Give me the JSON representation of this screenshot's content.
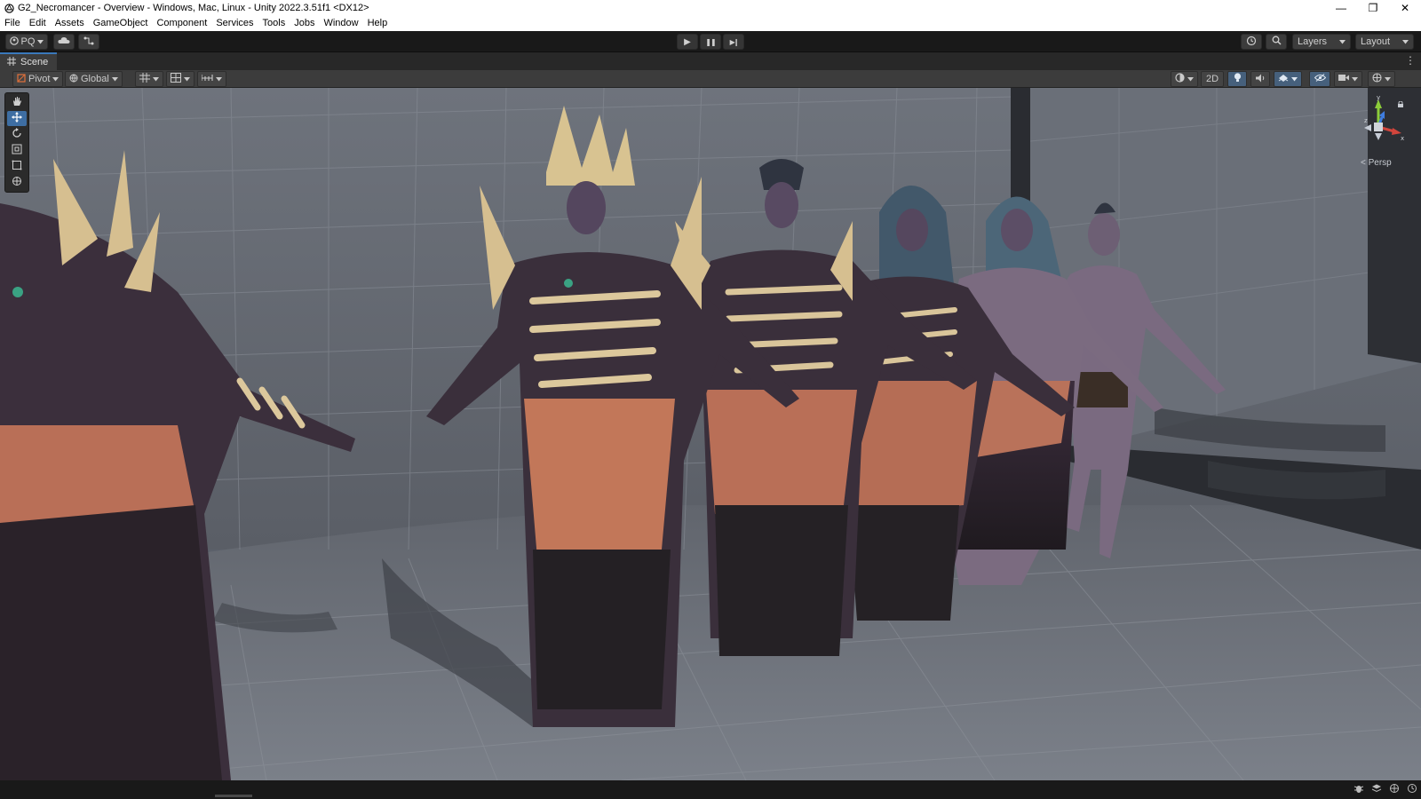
{
  "window": {
    "title": "G2_Necromancer - Overview - Windows, Mac, Linux - Unity 2022.3.51f1 <DX12>",
    "minimize_glyph": "—",
    "restore_glyph": "❐",
    "close_glyph": "✕"
  },
  "menu": {
    "items": [
      "File",
      "Edit",
      "Assets",
      "GameObject",
      "Component",
      "Services",
      "Tools",
      "Jobs",
      "Window",
      "Help"
    ]
  },
  "toolbar": {
    "account_label": "PQ",
    "play_glyph": "▶",
    "pause_glyph": "❚❚",
    "step_glyph": "▶❙",
    "layers_label": "Layers",
    "layout_label": "Layout"
  },
  "scene_tab": {
    "label": "Scene"
  },
  "scene_toolbar": {
    "pivot_label": "Pivot",
    "global_label": "Global",
    "mode_2d_label": "2D"
  },
  "viewport": {
    "camera_mode_label": "< Persp",
    "gizmo_axes": {
      "y": "y",
      "x": "x",
      "z": "z"
    }
  },
  "colors": {
    "accent": "#3a79bb",
    "grid_floor": "#6f747d",
    "grid_wall": "#7a7f88",
    "gizmo_x": "#d2453c",
    "gizmo_y": "#8ccc3a",
    "gizmo_z": "#3f7de0"
  },
  "icons": {
    "app": "unity-logo-icon",
    "tools": [
      "hand-icon",
      "move-icon",
      "rotate-icon",
      "scale-icon",
      "rect-tool-icon",
      "transform-icon"
    ],
    "status": [
      "bug-icon",
      "layers-stack-icon",
      "network-icon",
      "clock-icon"
    ]
  }
}
